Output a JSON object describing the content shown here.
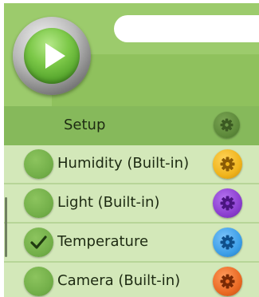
{
  "header": {
    "url_value": "",
    "play_icon": "play-icon"
  },
  "setup": {
    "label": "Setup",
    "icon": "gear-icon"
  },
  "sensors": [
    {
      "label": "Humidity (Built-in)",
      "checked": false,
      "gear_color": "#f0b41c"
    },
    {
      "label": "Light (Built-in)",
      "checked": false,
      "gear_color": "#8c3fd0"
    },
    {
      "label": "Temperature",
      "checked": true,
      "gear_color": "#3d9fe8"
    },
    {
      "label": "Camera (Built-in)",
      "checked": false,
      "gear_color": "#ea6a24"
    }
  ],
  "colors": {
    "header_bg": "#9ccb6c",
    "setup_bar": "#86b95b",
    "row_bg": "#d3e8b9"
  }
}
